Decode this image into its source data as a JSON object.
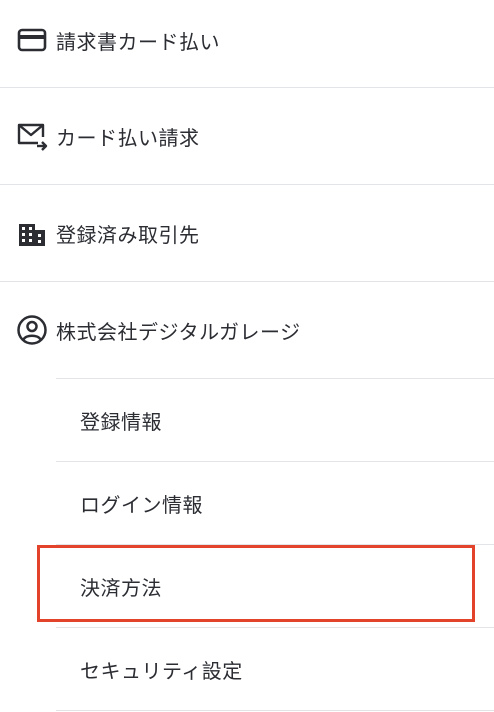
{
  "menu": {
    "items": [
      {
        "label": "請求書カード払い",
        "icon": "credit-card-icon"
      },
      {
        "label": "カード払い請求",
        "icon": "mail-send-icon"
      },
      {
        "label": "登録済み取引先",
        "icon": "building-icon"
      },
      {
        "label": "株式会社デジタルガレージ",
        "icon": "user-circle-icon"
      }
    ],
    "subitems": [
      {
        "label": "登録情報"
      },
      {
        "label": "ログイン情報"
      },
      {
        "label": "決済方法"
      },
      {
        "label": "セキュリティ設定"
      }
    ]
  },
  "colors": {
    "text": "#2b2d33",
    "divider": "#e3e4e8",
    "highlight": "#e2432a"
  }
}
